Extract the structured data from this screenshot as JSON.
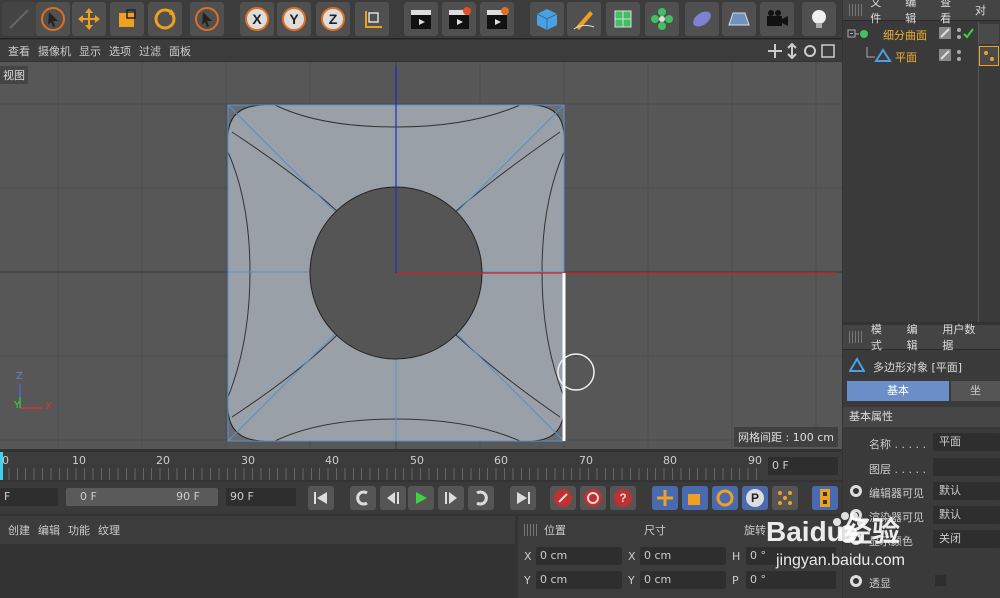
{
  "viewport_menu": [
    "查看",
    "摄像机",
    "显示",
    "选项",
    "过滤",
    "面板"
  ],
  "viewport_label": "视图",
  "grid_spacing": "网格间距 : 100 cm",
  "axis_labels": {
    "x": "X",
    "y": "Y",
    "z": "Z"
  },
  "toolbar_letters": {
    "x": "X",
    "y": "Y",
    "z": "Z"
  },
  "object_panel": {
    "menu": [
      "文件",
      "编辑",
      "查看",
      "对"
    ],
    "objects": [
      {
        "name": "细分曲面",
        "type": "subdivision"
      },
      {
        "name": "平面",
        "type": "plane"
      }
    ]
  },
  "timeline": {
    "ticks": [
      "0",
      "10",
      "20",
      "30",
      "40",
      "50",
      "60",
      "70",
      "80",
      "90"
    ],
    "current_frame": "0 F"
  },
  "transport": {
    "start": "F",
    "range_start": "0 F",
    "range_end": "90 F",
    "end": "90 F"
  },
  "material_menu": [
    "创建",
    "编辑",
    "功能",
    "纹理"
  ],
  "coords": {
    "headers": [
      "位置",
      "尺寸",
      "旋转"
    ],
    "rows": [
      {
        "axis": "X",
        "pos": "0 cm",
        "size_axis": "X",
        "size": "0 cm",
        "rot_axis": "H",
        "rot": "0 °"
      },
      {
        "axis": "Y",
        "pos": "0 cm",
        "size_axis": "Y",
        "size": "0 cm",
        "rot_axis": "P",
        "rot": "0 °"
      }
    ]
  },
  "attributes": {
    "menu": [
      "模式",
      "编辑",
      "用户数据"
    ],
    "object_title": "多边形对象 [平面]",
    "tabs": [
      "基本",
      "坐"
    ],
    "section": "基本属性",
    "fields": [
      {
        "label": "名称 . . . . .",
        "value": "平面"
      },
      {
        "label": "图层 . . . . .",
        "value": ""
      },
      {
        "label": "编辑器可见",
        "value": "默认"
      },
      {
        "label": "渲染器可见",
        "value": "默认"
      },
      {
        "label": "显示颜色",
        "value": "关闭"
      },
      {
        "label": "透显",
        "value": ""
      }
    ]
  },
  "watermark": {
    "brand": "Baidu经验",
    "url": "jingyan.baidu.com"
  }
}
